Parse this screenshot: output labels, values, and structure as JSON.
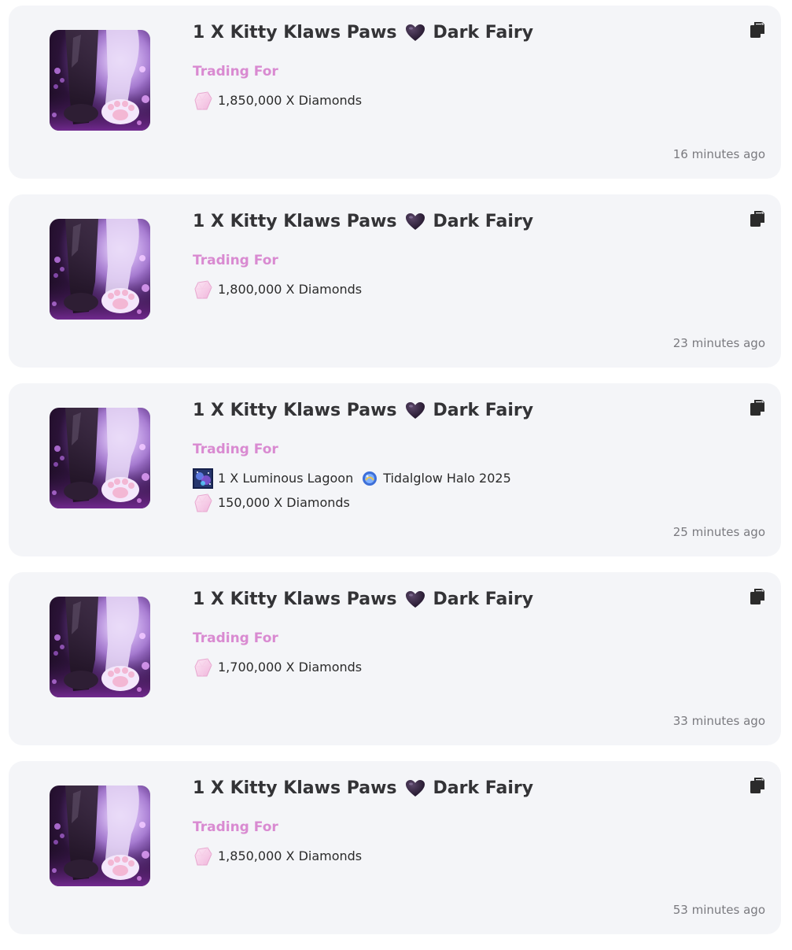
{
  "listings": [
    {
      "item_title": "1 X Kitty Klaws Paws",
      "variant": "Dark Fairy",
      "trading_for_label": "Trading For",
      "offers": [
        {
          "icon": "diamond-icon",
          "text": "1,850,000 X Diamonds"
        }
      ],
      "time_ago": "16 minutes ago"
    },
    {
      "item_title": "1 X Kitty Klaws Paws",
      "variant": "Dark Fairy",
      "trading_for_label": "Trading For",
      "offers": [
        {
          "icon": "diamond-icon",
          "text": "1,800,000 X Diamonds"
        }
      ],
      "time_ago": "23 minutes ago"
    },
    {
      "item_title": "1 X Kitty Klaws Paws",
      "variant": "Dark Fairy",
      "trading_for_label": "Trading For",
      "offers": [
        {
          "icon": "luminous-lagoon-icon",
          "text": "1 X Luminous Lagoon",
          "extra_icon": "halo-icon",
          "extra_text": "Tidalglow Halo 2025"
        },
        {
          "icon": "diamond-icon",
          "text": "150,000 X Diamonds"
        }
      ],
      "time_ago": "25 minutes ago"
    },
    {
      "item_title": "1 X Kitty Klaws Paws",
      "variant": "Dark Fairy",
      "trading_for_label": "Trading For",
      "offers": [
        {
          "icon": "diamond-icon",
          "text": "1,700,000 X Diamonds"
        }
      ],
      "time_ago": "33 minutes ago"
    },
    {
      "item_title": "1 X Kitty Klaws Paws",
      "variant": "Dark Fairy",
      "trading_for_label": "Trading For",
      "offers": [
        {
          "icon": "diamond-icon",
          "text": "1,850,000 X Diamonds"
        }
      ],
      "time_ago": "53 minutes ago"
    }
  ],
  "colors": {
    "card_bg": "#f4f5f8",
    "trading_label": "#d98ad1",
    "title_text": "#333336",
    "time_text": "#7a7a7f"
  }
}
